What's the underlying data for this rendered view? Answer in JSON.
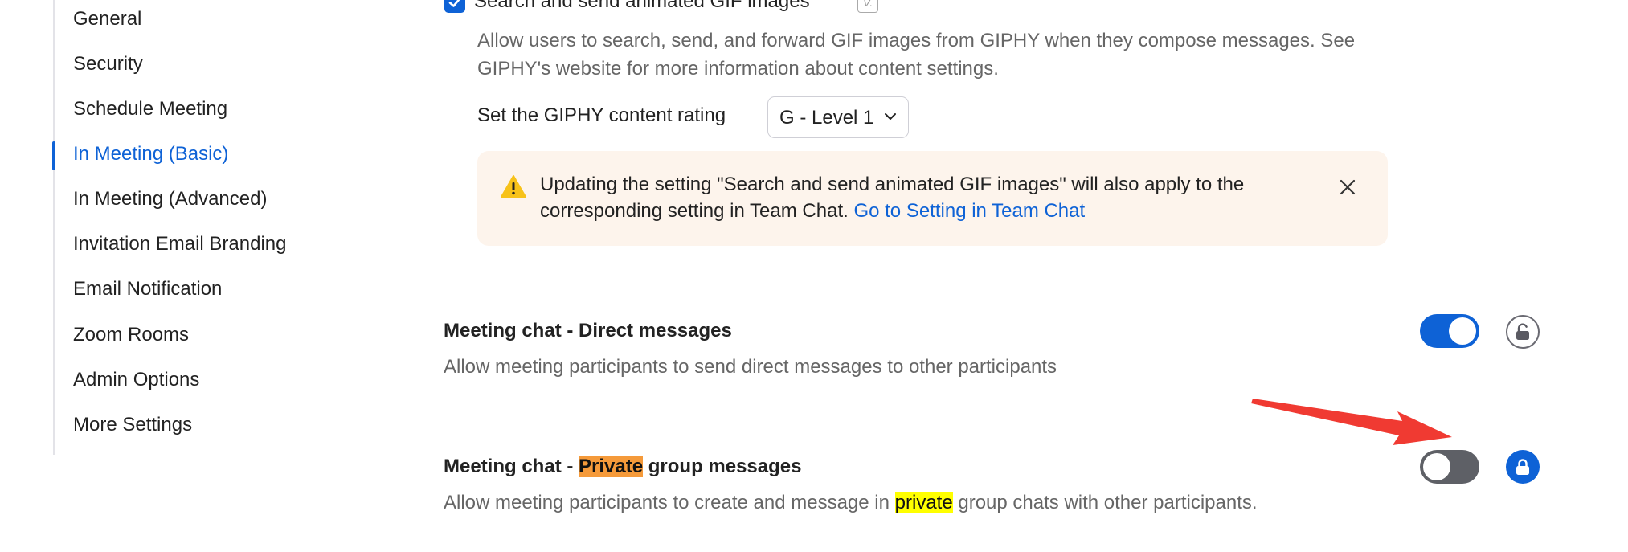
{
  "sidebar": {
    "items": [
      {
        "label": "General"
      },
      {
        "label": "Security"
      },
      {
        "label": "Schedule Meeting"
      },
      {
        "label": "In Meeting (Basic)"
      },
      {
        "label": "In Meeting (Advanced)"
      },
      {
        "label": "Invitation Email Branding"
      },
      {
        "label": "Email Notification"
      },
      {
        "label": "Zoom Rooms"
      },
      {
        "label": "Admin Options"
      },
      {
        "label": "More Settings"
      }
    ],
    "active_label": "In Meeting (Basic)"
  },
  "giphy": {
    "checkbox_label": "Search and send animated GIF images",
    "checked": true,
    "tag_badge_icon": "variable-tag-icon",
    "description": "Allow users to search, send, and forward GIF images from GIPHY when they compose messages. See GIPHY's website for more information about content settings.",
    "rating_label": "Set the GIPHY content rating",
    "rating_value": "G - Level 1",
    "notice": {
      "text": "Updating the setting \"Search and send animated GIF images\" will also apply to the corresponding setting in Team Chat.",
      "link": "Go to Setting in Team Chat",
      "icon": "warning-triangle-icon"
    }
  },
  "direct_messages": {
    "title": "Meeting chat - Direct messages",
    "description": "Allow meeting participants to send direct messages to other participants",
    "enabled": true,
    "locked": false
  },
  "private_group": {
    "title_prefix": "Meeting chat - ",
    "title_highlight": "Private",
    "title_suffix": " group messages",
    "desc_prefix": "Allow meeting participants to create and message in ",
    "desc_highlight": "private",
    "desc_suffix": " group chats with other participants.",
    "enabled": false,
    "locked": true
  },
  "colors": {
    "accent": "#0e62d6",
    "toggle_off": "#5e6066",
    "notice_bg": "#fdf4ec",
    "highlight_orange": "#f59a3a",
    "highlight_yellow": "#ffff00",
    "annotation_arrow": "#f03a32"
  }
}
